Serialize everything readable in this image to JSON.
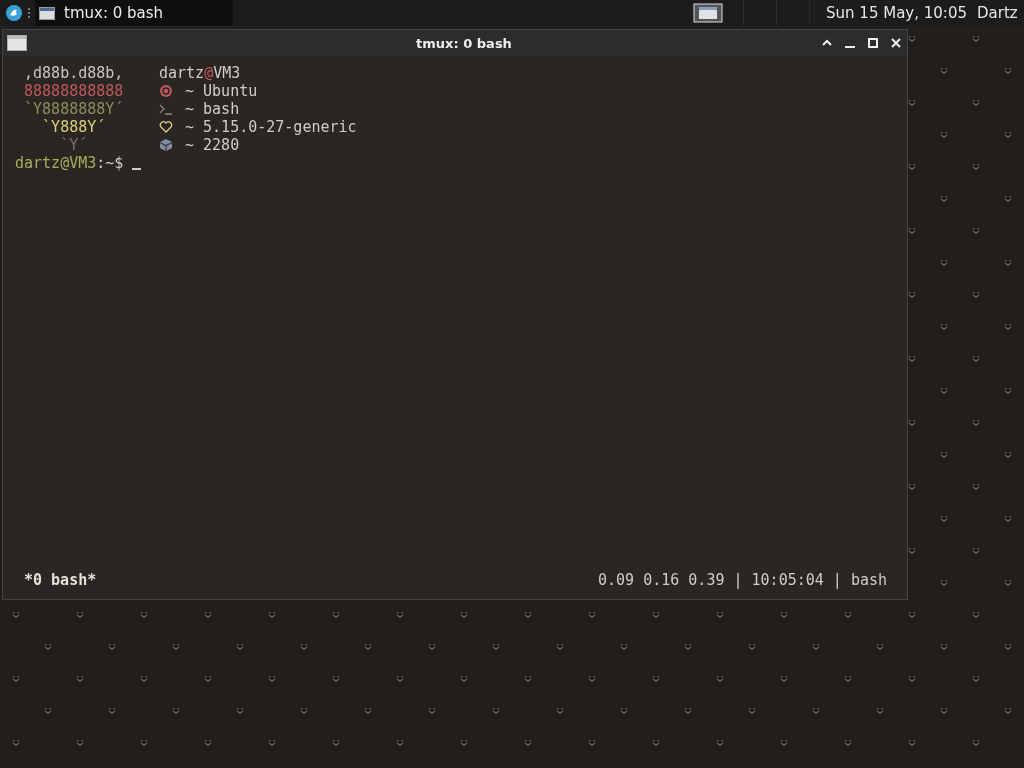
{
  "panel": {
    "task": {
      "title": "tmux: 0 bash",
      "selected": true
    },
    "clock": "Sun 15 May, 10:05",
    "user": "Dartz"
  },
  "window": {
    "title": "tmux: 0 bash"
  },
  "terminal": {
    "user_host": {
      "user": "dartz",
      "at": "@",
      "host": "VM3"
    },
    "logo": [
      {
        "text": " ,d88b.d88b,",
        "color": "#c9c6c0"
      },
      {
        "text": " 88888888888",
        "color": "#c0575c"
      },
      {
        "text": " `Y8888888Y´",
        "color": "#8e8e5c"
      },
      {
        "text": "   `Y888Y´",
        "color": "#d9cf7c"
      },
      {
        "text": "     `Y´",
        "color": "#75726d"
      }
    ],
    "info": [
      {
        "kind": "distro",
        "color": "#c0575c",
        "text": "~ Ubuntu"
      },
      {
        "kind": "shell",
        "color": "#8a8781",
        "text": "~ bash"
      },
      {
        "kind": "kernel",
        "color": "#d9cf7c",
        "text": "~ 5.15.0-27-generic"
      },
      {
        "kind": "packages",
        "color": "#7f8aa3",
        "text": "~ 2280"
      }
    ],
    "prompt": {
      "user_host": "dartz@VM3",
      "path": ":~$"
    },
    "status": {
      "window": "*0 bash*",
      "right": "0.09 0.16 0.39 | 10:05:04 | bash"
    }
  }
}
